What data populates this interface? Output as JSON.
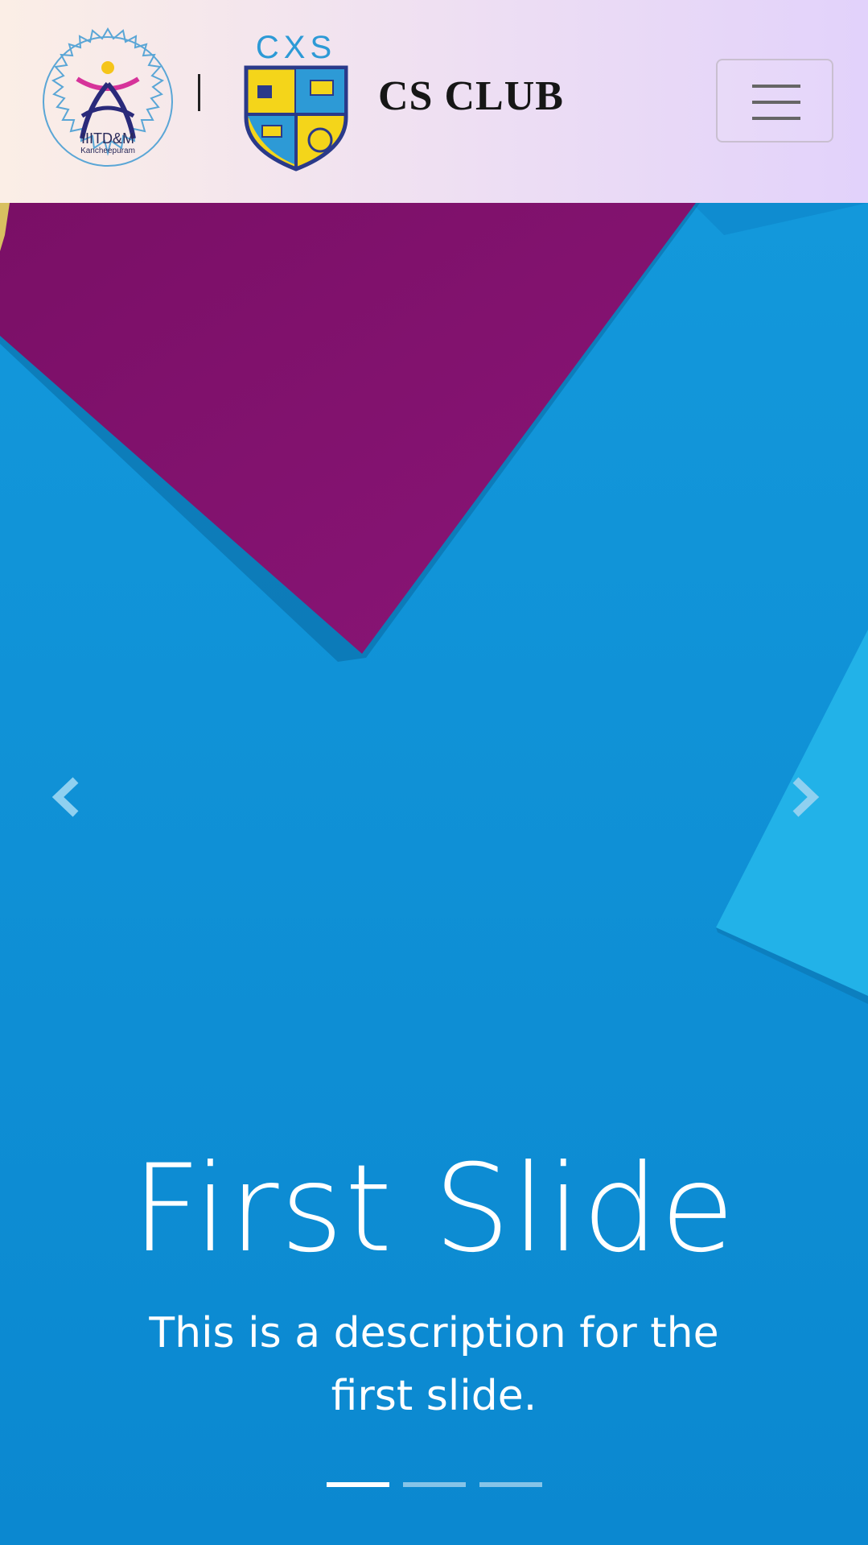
{
  "header": {
    "institute_logo_text": "IIITD&M",
    "institute_logo_subtext": "Kancheepuram",
    "separator": "|",
    "club_logo_text": "CXS",
    "brand": "CS CLUB",
    "menu_icon": "hamburger-icon"
  },
  "carousel": {
    "active_index": 0,
    "slide_count": 3,
    "slide": {
      "title": "First Slide",
      "description": "This is a description for the first slide."
    },
    "prev_icon": "chevron-left-icon",
    "next_icon": "chevron-right-icon"
  },
  "colors": {
    "navbar_start": "#fbeee6",
    "navbar_end": "#e2d2fb",
    "slide_blue": "#0d8fd6",
    "slide_purple": "#7e0f6c",
    "slide_light_blue": "#1aaee3"
  }
}
